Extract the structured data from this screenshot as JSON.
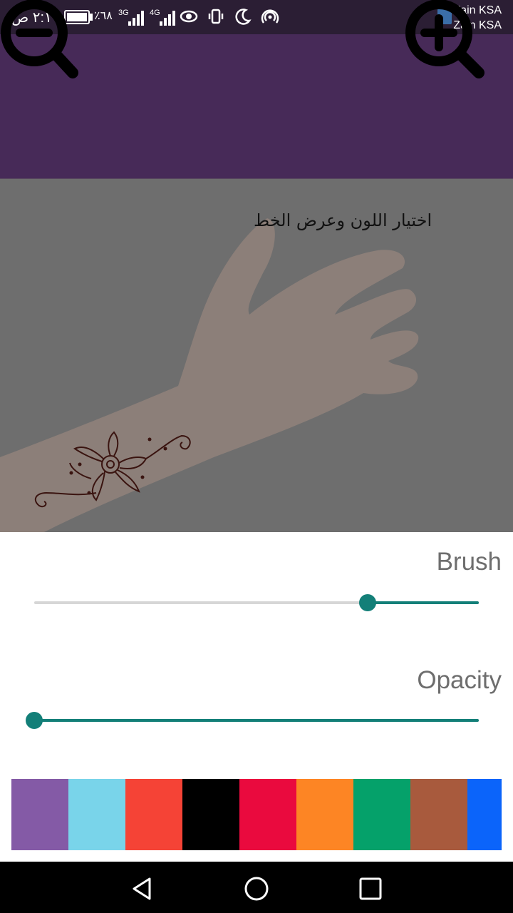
{
  "status_bar": {
    "time": "٢:١٠ ص",
    "battery_percent": "٪٦٨",
    "network_1": "3G",
    "network_2": "4G",
    "carrier_line_1": "Zain KSA",
    "carrier_line_2": "Zain KSA",
    "icons": [
      "eye-icon",
      "vibrate-icon",
      "moon-icon",
      "hotspot-icon"
    ]
  },
  "toolbar": {
    "zoom_out_icon": "zoom-out-icon",
    "zoom_in_icon": "zoom-in-icon"
  },
  "canvas": {
    "caption": "اختيار اللون وعرض الخط"
  },
  "settings": {
    "brush_label": "Brush",
    "brush_value": 0.75,
    "opacity_label": "Opacity",
    "opacity_value": 0.0
  },
  "palette": {
    "colors": [
      "#845aa6",
      "#79d4ea",
      "#f54336",
      "#000000",
      "#ea0a3e",
      "#fd8524",
      "#05a16a",
      "#a85a3d",
      "#0b64fa"
    ]
  },
  "navigation": {
    "back_icon": "back-triangle-icon",
    "home_icon": "home-circle-icon",
    "recents_icon": "recents-square-icon"
  },
  "colors": {
    "header_purple": "#472a58",
    "accent_teal": "#137f78",
    "canvas_overlay": "#6e6e6e"
  }
}
